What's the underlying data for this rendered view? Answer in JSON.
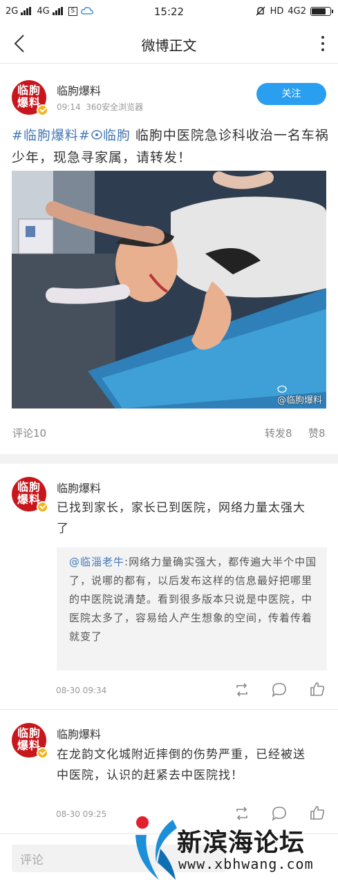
{
  "status_bar": {
    "signal_left": "2G",
    "signal_mid": "4G",
    "s_icon": "S",
    "time": "15:22",
    "hd": "HD",
    "network_right": "4G2",
    "battery_level": 0.85
  },
  "nav": {
    "title": "微博正文"
  },
  "post": {
    "author": "临朐爆料",
    "avatar_text": "临朐爆料",
    "time": "09:14",
    "source": "360安全浏览器",
    "follow_label": "关注",
    "tag1": "#临朐爆料#",
    "location_tag": "临朐",
    "text": " 临朐中医院急诊科收治一名车祸少年，现急寻家属，请转发！",
    "watermark": "@临朐爆料",
    "comments_label": "评论10",
    "reposts_label": "转发8",
    "likes_label": "赞8"
  },
  "comments": [
    {
      "author": "临朐爆料",
      "avatar_text": "临朐爆料",
      "text": "已找到家长，家长已到医院，网络力量太强大了",
      "quote_user": "@临淄老牛",
      "quote_text": ":网络力量确实强大，都传遍大半个中国了，说哪的都有，以后发布这样的信息最好把哪里的中医院说清楚。看到很多版本只说是中医院，中医院太多了，容易给人产生想象的空间，传着传着就变了",
      "time": "08-30 09:34"
    },
    {
      "author": "临朐爆料",
      "avatar_text": "临朐爆料",
      "text": "在龙韵文化城附近摔倒的伤势严重，已经被送中医院，认识的赶紧去中医院找！",
      "time": "08-30 09:25"
    }
  ],
  "bottom": {
    "comment_placeholder": "评论"
  },
  "overlay": {
    "site_name": "新滨海论坛",
    "site_url": "www.xbhwang.com"
  },
  "colors": {
    "accent": "#2a9ff0",
    "tag": "#4478b8",
    "avatar": "#c8161d",
    "badge": "#f2b418"
  }
}
